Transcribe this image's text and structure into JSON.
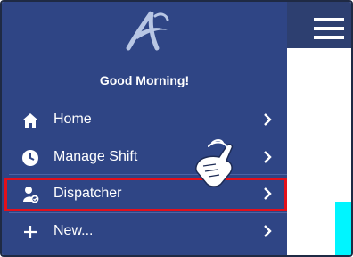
{
  "sidebar": {
    "greeting": "Good Morning!",
    "items": [
      {
        "label": "Home",
        "icon": "home-icon"
      },
      {
        "label": "Manage Shift",
        "icon": "clock-icon"
      },
      {
        "label": "Dispatcher",
        "icon": "dispatcher-icon",
        "highlighted": true
      },
      {
        "label": "New...",
        "icon": "plus-icon"
      }
    ]
  },
  "colors": {
    "sidebar_bg": "#2f4585",
    "topbar_bg": "#2d3f70",
    "highlight": "#e3101b",
    "accent_block": "#00f5ff"
  }
}
